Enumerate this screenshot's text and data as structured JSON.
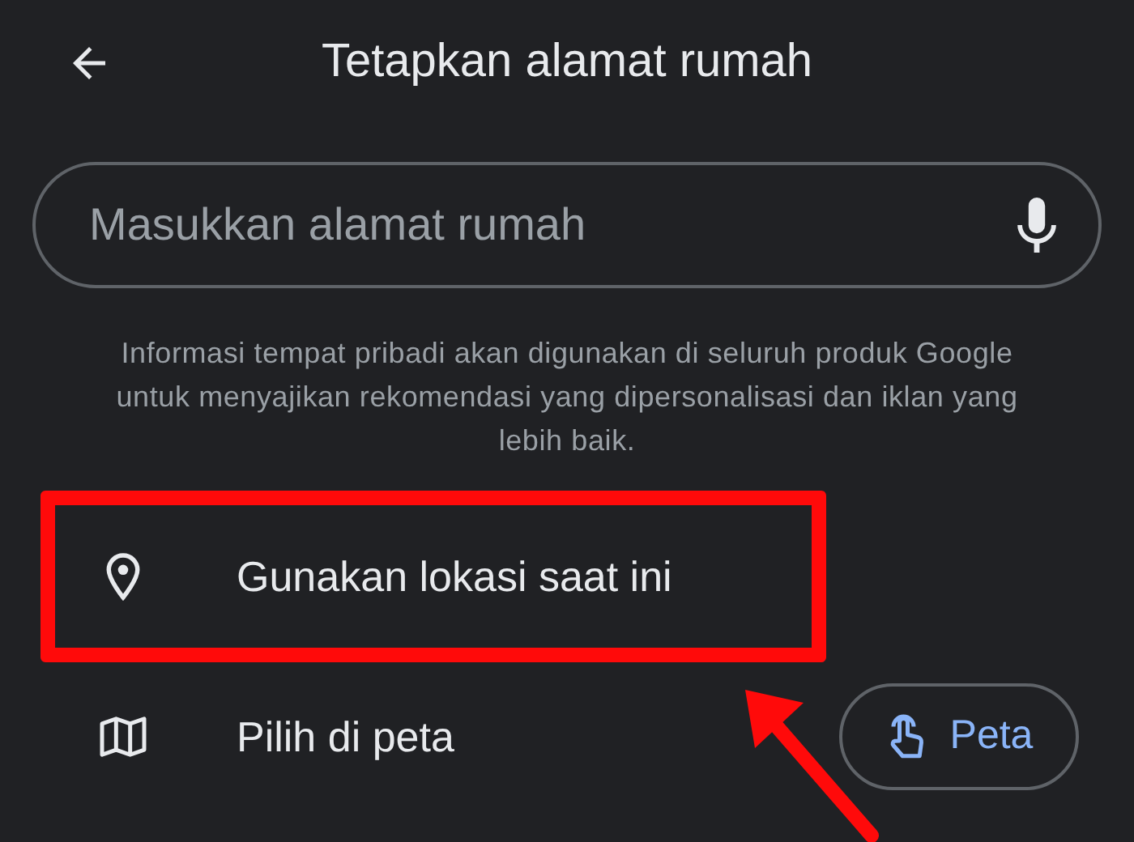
{
  "header": {
    "title": "Tetapkan alamat rumah"
  },
  "search": {
    "placeholder": "Masukkan alamat rumah"
  },
  "info": "Informasi tempat pribadi akan digunakan di seluruh produk Google untuk menyajikan rekomendasi yang dipersonalisasi dan iklan yang lebih baik.",
  "options": [
    {
      "kind": "location",
      "label": "Gunakan lokasi saat ini",
      "highlighted": true
    },
    {
      "kind": "map",
      "label": "Pilih di peta",
      "highlighted": false
    }
  ],
  "map_button": {
    "label": "Peta"
  },
  "pointer_arrow": true
}
